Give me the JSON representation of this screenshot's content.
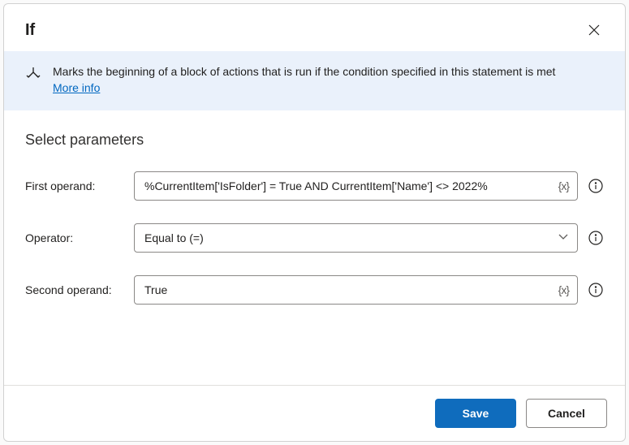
{
  "header": {
    "title": "If"
  },
  "banner": {
    "text": "Marks the beginning of a block of actions that is run if the condition specified in this statement is met",
    "link": "More info"
  },
  "section": {
    "title": "Select parameters"
  },
  "params": {
    "first_operand": {
      "label": "First operand:",
      "value": "%CurrentItem['IsFolder'] = True AND CurrentItem['Name'] <> 2022%"
    },
    "operator": {
      "label": "Operator:",
      "value": "Equal to (=)"
    },
    "second_operand": {
      "label": "Second operand:",
      "value": "True"
    }
  },
  "var_badge": "{x}",
  "footer": {
    "save": "Save",
    "cancel": "Cancel"
  }
}
